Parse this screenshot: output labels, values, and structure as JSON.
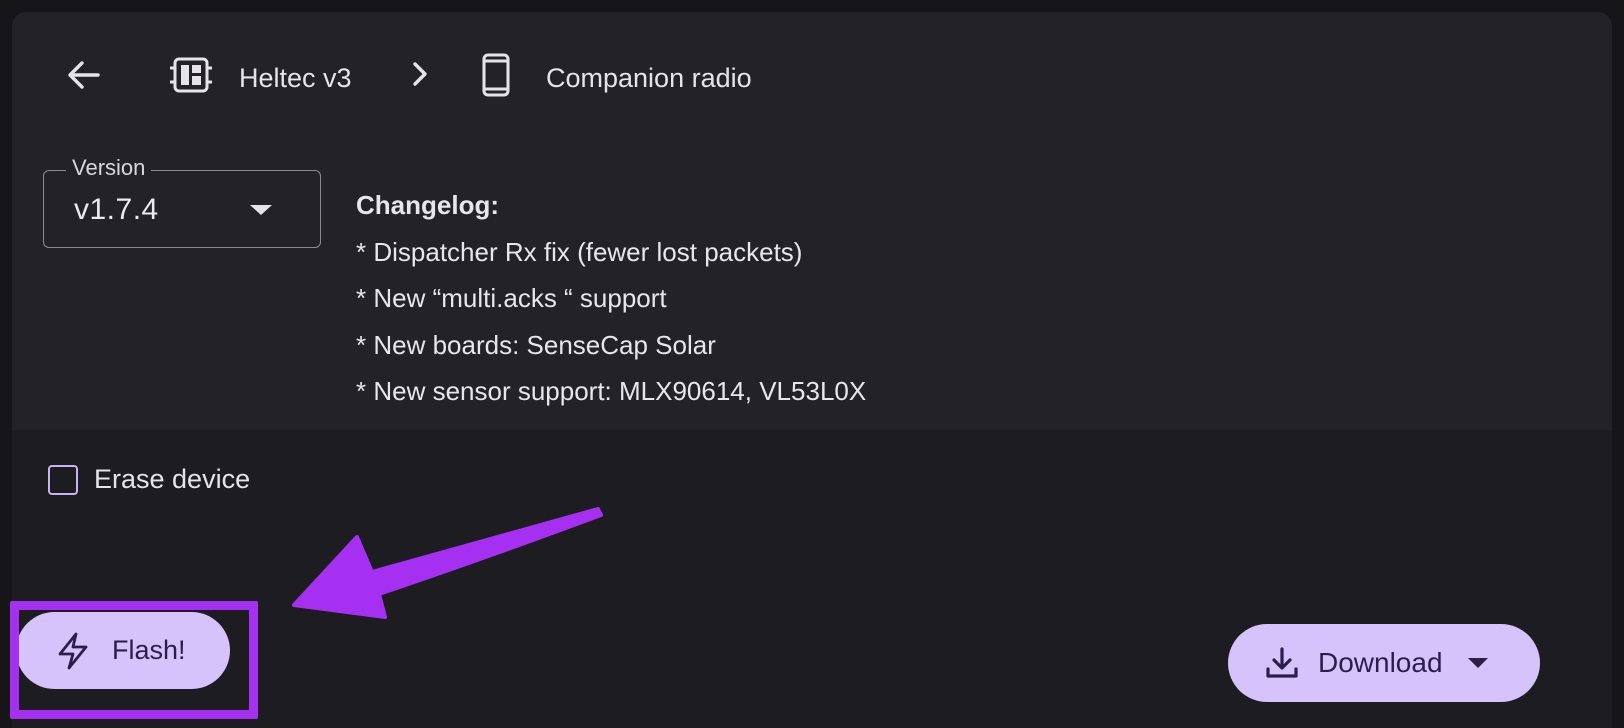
{
  "header": {
    "board_label": "Heltec v3",
    "firmware_label": "Companion radio",
    "icons": [
      "back-arrow-icon",
      "board-icon",
      "chevron-right-icon",
      "phone-icon"
    ]
  },
  "version": {
    "legend": "Version",
    "selected": "v1.7.4"
  },
  "changelog": {
    "title": "Changelog:",
    "items": [
      "* Dispatcher Rx fix (fewer lost packets)",
      "* New “multi.acks “ support",
      "* New boards: SenseCap Solar",
      "* New sensor support: MLX90614, VL53L0X"
    ]
  },
  "options": {
    "erase_label": "Erase device",
    "erase_checked": false
  },
  "actions": {
    "flash_label": "Flash!",
    "download_label": "Download"
  },
  "colors": {
    "background": "#161618",
    "panel": "#232327",
    "button_fill": "#d6c3fb",
    "button_text": "#2a1f4a",
    "annotation": "#a530f2"
  }
}
